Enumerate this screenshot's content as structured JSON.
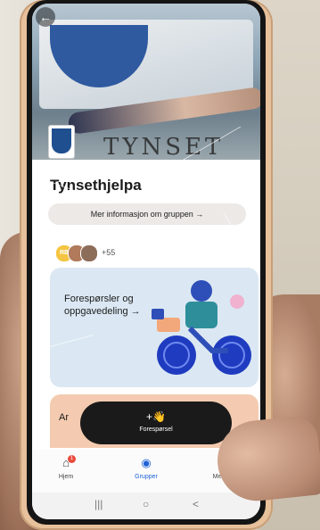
{
  "header": {
    "hero_text": "TYNSET",
    "back_icon": "arrow-left-icon"
  },
  "group": {
    "title": "Tynsethjelpa",
    "info_link": "Mer informasjon om gruppen →",
    "members": {
      "first_initials": "RB",
      "count_label": "+55"
    }
  },
  "cards": [
    {
      "title": "Forespørsler og oppgavedeling →"
    },
    {
      "title": "Ar"
    }
  ],
  "fab": {
    "icon": "+👋",
    "label": "Forespørsel"
  },
  "tabbar": {
    "items": [
      {
        "label": "Hjem",
        "icon": "home-icon",
        "badge": "1"
      },
      {
        "label": "Grupper",
        "icon": "globe-icon"
      },
      {
        "label": "Meldinger",
        "icon": "chat-icon"
      }
    ]
  },
  "system_nav": {
    "recent": "|||",
    "home": "○",
    "back": "<"
  }
}
